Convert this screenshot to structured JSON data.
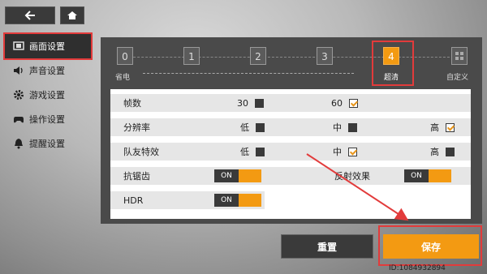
{
  "nav": {
    "back_icon": "back-arrow-icon",
    "home_icon": "home-icon"
  },
  "sidebar": {
    "items": [
      {
        "label": "画面设置",
        "icon": "display-icon",
        "active": true
      },
      {
        "label": "声音设置",
        "icon": "speaker-icon"
      },
      {
        "label": "游戏设置",
        "icon": "gear-icon"
      },
      {
        "label": "操作设置",
        "icon": "gamepad-icon"
      },
      {
        "label": "提醒设置",
        "icon": "bell-icon"
      }
    ]
  },
  "quality_levels": {
    "levels": [
      "0",
      "1",
      "2",
      "3",
      "4"
    ],
    "selected": "4",
    "captions": {
      "left": "省电",
      "selected": "超清",
      "custom": "自定义"
    }
  },
  "settings": {
    "fps": {
      "label": "帧数",
      "opt1": "30",
      "opt2": "60",
      "selected": "60"
    },
    "resolution": {
      "label": "分辨率",
      "low": "低",
      "mid": "中",
      "high": "高",
      "selected": "高"
    },
    "teammate_fx": {
      "label": "队友特效",
      "low": "低",
      "mid": "中",
      "high": "高",
      "selected": "中"
    },
    "antialias": {
      "label": "抗锯齿",
      "value": "ON"
    },
    "reflection": {
      "label": "反射效果",
      "value": "ON"
    },
    "hdr": {
      "label": "HDR",
      "value": "ON"
    }
  },
  "buttons": {
    "reset": "重置",
    "save": "保存"
  },
  "footer": {
    "id": "ID:1084932894"
  },
  "colors": {
    "accent": "#f39a12",
    "highlight": "#e23b3b",
    "dark": "#3a3a3a"
  }
}
